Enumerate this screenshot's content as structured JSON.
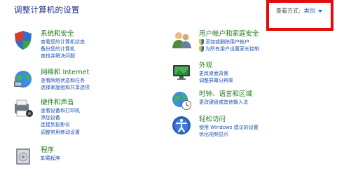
{
  "header": {
    "title": "调整计算机的设置",
    "view_by_label": "查看方式:",
    "view_by_value": "类别"
  },
  "categories": [
    {
      "name": "系统和安全",
      "links": [
        "查看您的计算机状态",
        "备份您的计算机",
        "查找并解决问题"
      ]
    },
    {
      "name": "网络和 Internet",
      "links": [
        "查看网络状态和任务",
        "选择家庭组和共享选项"
      ]
    },
    {
      "name": "硬件和声音",
      "links": [
        "查看设备和打印机",
        "添加设备",
        "连接到投影仪",
        "调整常用移动设置"
      ]
    },
    {
      "name": "程序",
      "links": [
        "卸载程序"
      ]
    },
    {
      "name": "用户帐户和家庭安全",
      "links": [
        "添加或删除用户帐户",
        "为所有用户设置家长控制"
      ]
    },
    {
      "name": "外观",
      "links": [
        "更改桌面背景",
        "调整屏幕分辨率"
      ]
    },
    {
      "name": "时钟、语言和区域",
      "links": [
        "更改键盘或其他输入法"
      ]
    },
    {
      "name": "轻松访问",
      "links": [
        "使用 Windows 建议的设置",
        "优化视频显示"
      ]
    }
  ],
  "colors": {
    "title": "#1e3287",
    "category_heading": "#1f7a1f",
    "link": "#1f4fb5",
    "highlight_box": "#e30b0b"
  },
  "icons": [
    "system-security-icon",
    "network-icon",
    "hardware-sound-icon",
    "programs-icon",
    "user-accounts-icon",
    "appearance-icon",
    "clock-language-icon",
    "ease-of-access-icon",
    "uac-shield-icon"
  ]
}
